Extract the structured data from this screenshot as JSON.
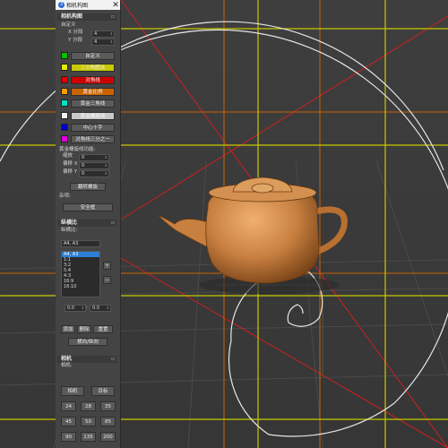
{
  "window": {
    "title": "相机构图",
    "icon": "3",
    "close": "✕"
  },
  "composition": {
    "header": "相机构图",
    "custom_label": "自定义",
    "x_label": "X 分段",
    "x_value": "4",
    "y_label": "Y 分段",
    "y_value": "4",
    "rows": [
      {
        "swatch": "#00c000",
        "label": "自定义",
        "bg": "#5a5a5a",
        "fg": "#e8e8e8"
      },
      {
        "swatch": "#e8e800",
        "label": "三分构图法",
        "bg": "#c8c800",
        "fg": "#f0f0f0"
      },
      {
        "swatch": "#e00000",
        "label": "对角线",
        "bg": "#cc0000",
        "fg": "#f4f4f4"
      },
      {
        "swatch": "#ff9a00",
        "label": "黄金比例",
        "bg": "#c86400",
        "fg": "#f4f4f4"
      },
      {
        "swatch": "#00e0c8",
        "label": "黄金三角线",
        "bg": "#5a5a5a",
        "fg": "#e8e8e8"
      },
      {
        "swatch": "#f4f4f4",
        "label": "黄金螺旋线",
        "bg": "#c8c8c8",
        "fg": "#f8f8f8"
      },
      {
        "swatch": "#0000c8",
        "label": "中心十字",
        "bg": "#5a5a5a",
        "fg": "#e8e8e8"
      },
      {
        "swatch": "#e000e0",
        "label": "对角线三分之一",
        "bg": "#5a5a5a",
        "fg": "#e8e8e8"
      }
    ],
    "spiral_label": "黄金螺旋线功能:",
    "scale_label": "缩放",
    "scale_value": "0",
    "offx_label": "偏移 X",
    "offx_value": "0",
    "offy_label": "偏移 Y",
    "offy_value": "0",
    "flip_button": "翻转螺旋",
    "misc_label": "杂项:",
    "safe_button": "安全框"
  },
  "aspect": {
    "header": "纵横比",
    "label": "纵横比:",
    "current": "A4, A3",
    "list": [
      "A4, A3",
      "1:1",
      "3:2",
      "5:4",
      "4:3",
      "16:9",
      "16:10"
    ],
    "selected_index": 0,
    "plus": "+",
    "minus": "−",
    "w_value": "0.0",
    "h_value": "0.0",
    "add": "添加",
    "delete": "删除",
    "reset": "重置",
    "orient": "横向/纵向"
  },
  "camera": {
    "header": "相机",
    "label": "相机:",
    "camera_button": "相机",
    "target_button": "目标",
    "focal": [
      "24",
      "28",
      "35",
      "45",
      "50",
      "85",
      "90",
      "135",
      "200"
    ]
  },
  "scene": {
    "colors": {
      "third": "#c8c800",
      "diagonal": "#cc2020",
      "golden": "#c86400",
      "spiral": "#e6e6e6"
    }
  }
}
